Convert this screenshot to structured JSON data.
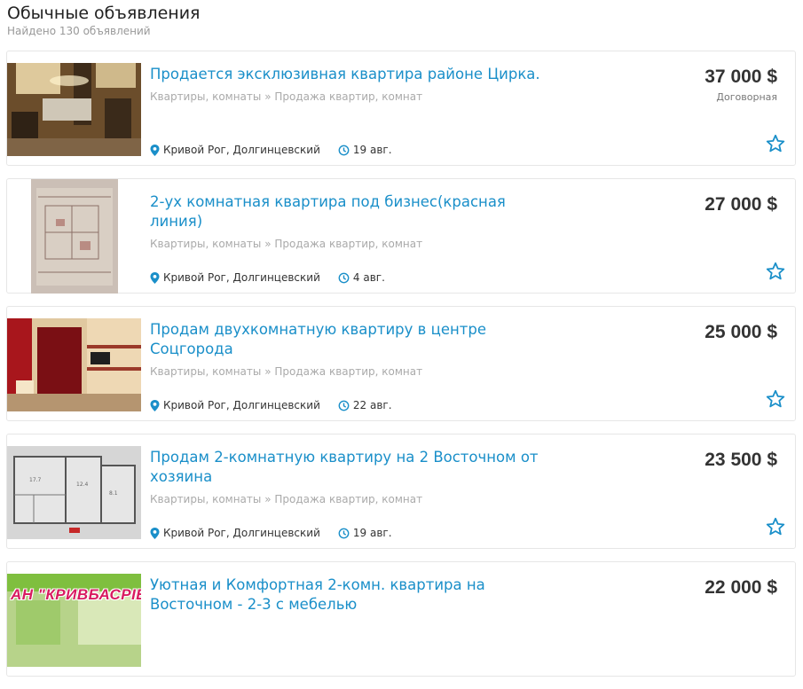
{
  "header": {
    "title": "Обычные объявления",
    "subtitle": "Найдено 130 объявлений"
  },
  "colors": {
    "link": "#1a8fc9",
    "accent": "#1a8fc9",
    "watermark": "#d81b60"
  },
  "listings": [
    {
      "title": "Продается эксклюзивная квартира районе Цирка.",
      "category": "Квартиры, комнаты » Продажа квартир, комнат",
      "location": "Кривой Рог, Долгинцевский",
      "date": "19 авг.",
      "price": "37 000 $",
      "price_note": "Договорная",
      "thumb": "interior-photo"
    },
    {
      "title": "2-ух комнатная квартира под бизнес(красная линия)",
      "category": "Квартиры, комнаты » Продажа квартир, комнат",
      "location": "Кривой Рог, Долгинцевский",
      "date": "4 авг.",
      "price": "27 000 $",
      "thumb": "floor-plan-paper"
    },
    {
      "title": "Продам двухкомнатную квартиру в центре Соцгорода",
      "category": "Квартиры, комнаты » Продажа квартир, комнат",
      "location": "Кривой Рог, Долгинцевский",
      "date": "22 авг.",
      "price": "25 000 $",
      "thumb": "red-room-photo"
    },
    {
      "title": "Продам 2-комнатную квартиру на 2 Восточном от хозяина",
      "category": "Квартиры, комнаты » Продажа квартир, комнат",
      "location": "Кривой Рог, Долгинцевский",
      "date": "19 авг.",
      "price": "23 500 $",
      "thumb": "floor-plan-drawing"
    },
    {
      "title": "Уютная и Комфортная 2-комн. квартира на Восточном - 2-3 с мебелью",
      "price": "22 000 $",
      "thumb": "green-room-photo",
      "watermark": "АН \"КРИВБАСРІЕЛТ\""
    }
  ]
}
